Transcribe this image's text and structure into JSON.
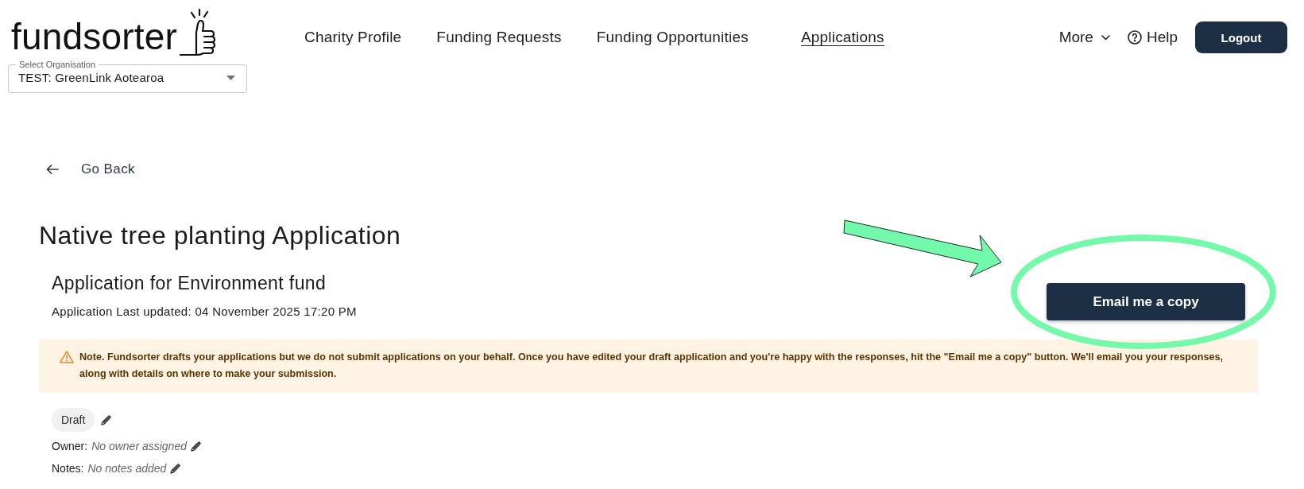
{
  "logo": {
    "text": "fundsorter"
  },
  "org_select": {
    "label": "Select Organisation",
    "value": "TEST: GreenLink Aotearoa"
  },
  "nav": {
    "items": [
      {
        "label": "Charity Profile",
        "selected": false
      },
      {
        "label": "Funding Requests",
        "selected": false
      },
      {
        "label": "Funding Opportunities",
        "selected": false
      },
      {
        "label": "Applications",
        "selected": true
      }
    ],
    "more": "More",
    "help": "Help",
    "logout": "Logout"
  },
  "back_link": "Go Back",
  "application": {
    "title": "Native tree planting Application",
    "subtitle": "Application for Environment fund",
    "last_updated": "Application Last updated: 04 November 2025 17:20 PM",
    "email_button": "Email me a copy"
  },
  "note": "Note. Fundsorter drafts your applications but we do not submit applications on your behalf. Once you have edited your draft application and you're happy with the responses, hit the \"Email me a copy\" button. We'll email you your responses, along with details on where to make your submission.",
  "status": {
    "label": "Draft"
  },
  "fields": [
    {
      "label": "Owner:",
      "value": "No owner assigned"
    },
    {
      "label": "Notes:",
      "value": "No notes added"
    }
  ]
}
